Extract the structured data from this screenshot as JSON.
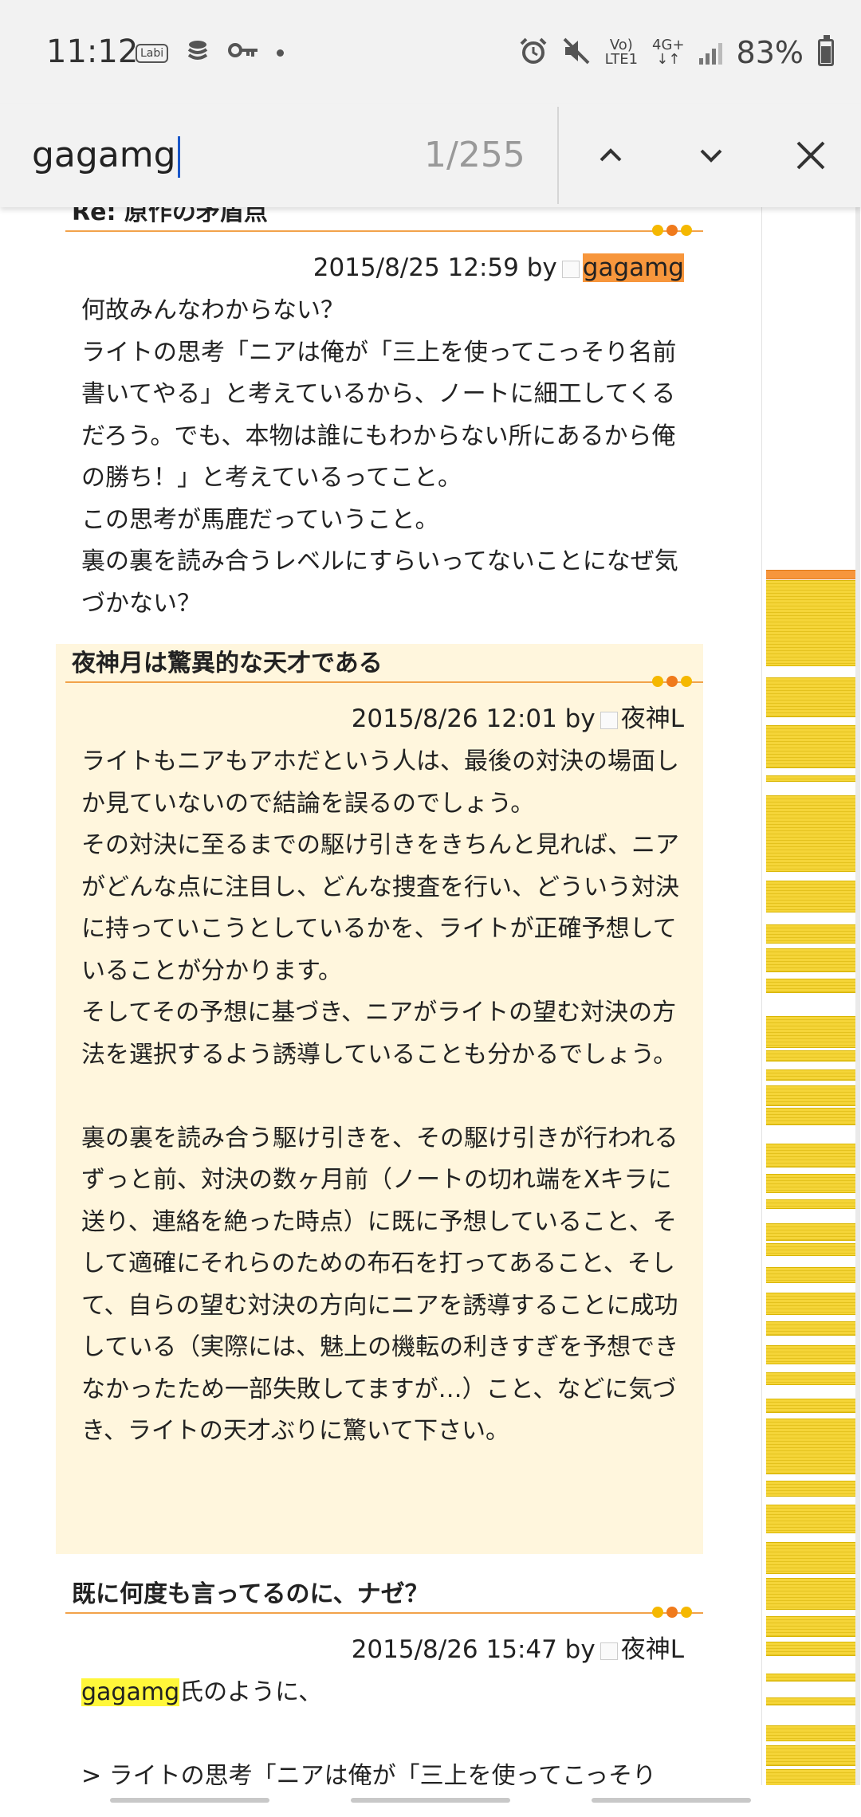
{
  "status_bar": {
    "time": "11:12",
    "left_icons": [
      "labi-icon",
      "stack-icon",
      "key-icon",
      "dot-icon"
    ],
    "labi_label": "Labi",
    "network_top": "Vo)",
    "network_bottom": "LTE1",
    "net_type": "4G+",
    "battery": "83%"
  },
  "find_bar": {
    "query": "gagamg",
    "count": "1/255"
  },
  "posts": [
    {
      "title": "Re: 原作の矛盾点",
      "date": "2015/8/25 12:59 by",
      "author": "gagamg",
      "body": [
        "何故みんなわからない？",
        "ライトの思考「ニアは俺が「三上を使ってこっそり名前書いてやる」と考えているから、ノートに細工してくるだろう。でも、本物は誰にもわからない所にあるから俺の勝ち！」と考えているってこと。",
        "この思考が馬鹿だっていうこと。",
        "裏の裏を読み合うレベルにすらいってないことになぜ気づかない？"
      ]
    },
    {
      "title": "夜神月は驚異的な天才である",
      "date": "2015/8/26 12:01 by",
      "author": "夜神L",
      "body1": [
        "ライトもニアもアホだという人は、最後の対決の場面しか見ていないので結論を誤るのでしょう。",
        "その対決に至るまでの駆け引きをきちんと見れば、ニアがどんな点に注目し、どんな捜査を行い、どういう対決に持っていこうとしているかを、ライトが正確予想していることが分かります。",
        "そしてその予想に基づき、ニアがライトの望む対決の方法を選択するよう誘導していることも分かるでしょう。"
      ],
      "body2": [
        "裏の裏を読み合う駆け引きを、その駆け引きが行われるずっと前、対決の数ヶ月前（ノートの切れ端をXキラに送り、連絡を絶った時点）に既に予想していること、そして適確にそれらのための布石を打ってあること、そして、自らの望む対決の方向にニアを誘導することに成功している（実際には、魅上の機転の利きすぎを予想できなかったため一部失敗してますが…）こと、などに気づき、ライトの天才ぶりに驚いて下さい。"
      ]
    },
    {
      "title": "既に何度も言ってるのに、ナゼ？",
      "date": "2015/8/26 15:47 by",
      "author": "夜神L",
      "highlight": "gagamg",
      "line1_rest": "氏のように、",
      "line2": "> ライトの思考「ニアは俺が「三上を使ってこっそり"
    }
  ],
  "colors": {
    "current_match": "#f7963c",
    "match": "#fff73a",
    "alt_post_bg": "#fff6dd",
    "accent_rule": "#f2a24a"
  }
}
